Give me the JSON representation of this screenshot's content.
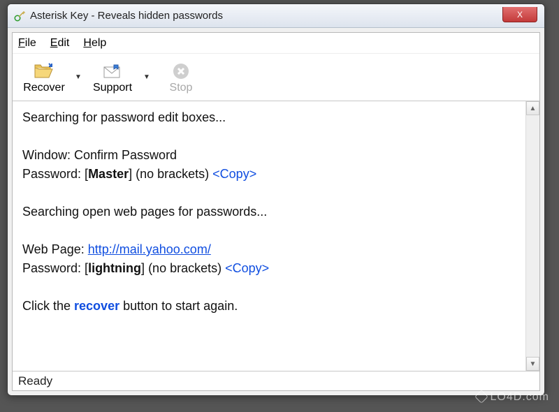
{
  "window": {
    "title": "Asterisk Key - Reveals hidden passwords",
    "close_label": "X"
  },
  "menu": {
    "file": "File",
    "edit": "Edit",
    "help": "Help"
  },
  "toolbar": {
    "recover": "Recover",
    "support": "Support",
    "stop": "Stop"
  },
  "log": {
    "line1": "Searching for password edit boxes...",
    "win_label": "Window: ",
    "win_value": "Confirm Password",
    "pwd_label": "Password: ",
    "pwd1_value": "Master",
    "no_brackets": " (no brackets) ",
    "copy": "<Copy>",
    "line4": "Searching open web pages for passwords...",
    "wp_label": "Web Page: ",
    "wp_url": "http://mail.yahoo.com/",
    "pwd2_value": "lightning",
    "click_prefix": "Click the ",
    "recover_word": "recover",
    "click_suffix": " button to start again."
  },
  "status": {
    "text": "Ready"
  },
  "watermark": {
    "text": "LO4D.com"
  }
}
